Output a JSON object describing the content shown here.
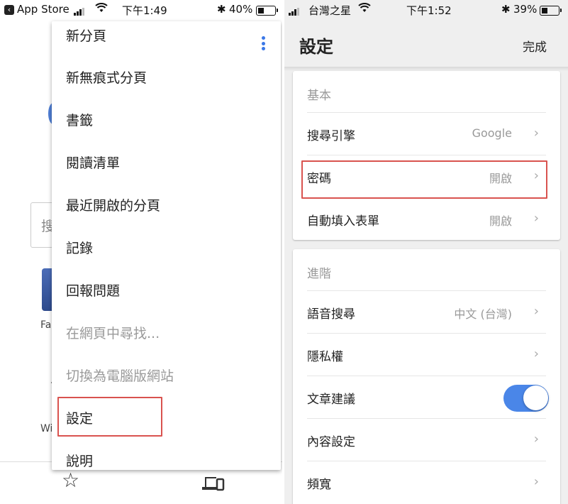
{
  "left_screen": {
    "status_bar": {
      "back_app": "App Store",
      "time": "下午1:49",
      "battery": "40%",
      "battery_level": 0.4
    },
    "background_page": {
      "search_partial": "搜",
      "tile_label_partial": "Fa",
      "tile2_label_partial": "Wi"
    },
    "menu": {
      "items": [
        {
          "label": "新分頁",
          "enabled": true
        },
        {
          "label": "新無痕式分頁",
          "enabled": true
        },
        {
          "label": "書籤",
          "enabled": true
        },
        {
          "label": "閱讀清單",
          "enabled": true
        },
        {
          "label": "最近開啟的分頁",
          "enabled": true
        },
        {
          "label": "記錄",
          "enabled": true
        },
        {
          "label": "回報問題",
          "enabled": true
        },
        {
          "label": "在網頁中尋找...",
          "enabled": false
        },
        {
          "label": "切換為電腦版網站",
          "enabled": false
        },
        {
          "label": "設定",
          "enabled": true,
          "highlighted": true
        },
        {
          "label": "說明",
          "enabled": true
        }
      ]
    },
    "bottom_toolbar": {
      "star_icon": "☆",
      "devices_icon": "devices"
    }
  },
  "right_screen": {
    "status_bar": {
      "carrier": "台灣之星",
      "time": "下午1:52",
      "battery": "39%",
      "battery_level": 0.39
    },
    "header": {
      "title": "設定",
      "done_label": "完成"
    },
    "sections": [
      {
        "title": "基本",
        "rows": [
          {
            "label": "搜尋引擎",
            "value": "Google",
            "chevron": "›"
          },
          {
            "label": "密碼",
            "value": "開啟",
            "chevron": "›",
            "highlighted": true
          },
          {
            "label": "自動填入表單",
            "value": "開啟",
            "chevron": "›"
          }
        ]
      },
      {
        "title": "進階",
        "rows": [
          {
            "label": "語音搜尋",
            "value": "中文 (台灣)",
            "chevron": "›"
          },
          {
            "label": "隱私權",
            "value": "",
            "chevron": "›"
          },
          {
            "label": "文章建議",
            "toggle": true,
            "toggle_on": true
          },
          {
            "label": "內容設定",
            "value": "",
            "chevron": "›"
          },
          {
            "label": "頻寬",
            "value": "",
            "chevron": "›"
          }
        ]
      }
    ],
    "accent_color": "#4a86e8",
    "highlight_color": "#d9534f"
  }
}
